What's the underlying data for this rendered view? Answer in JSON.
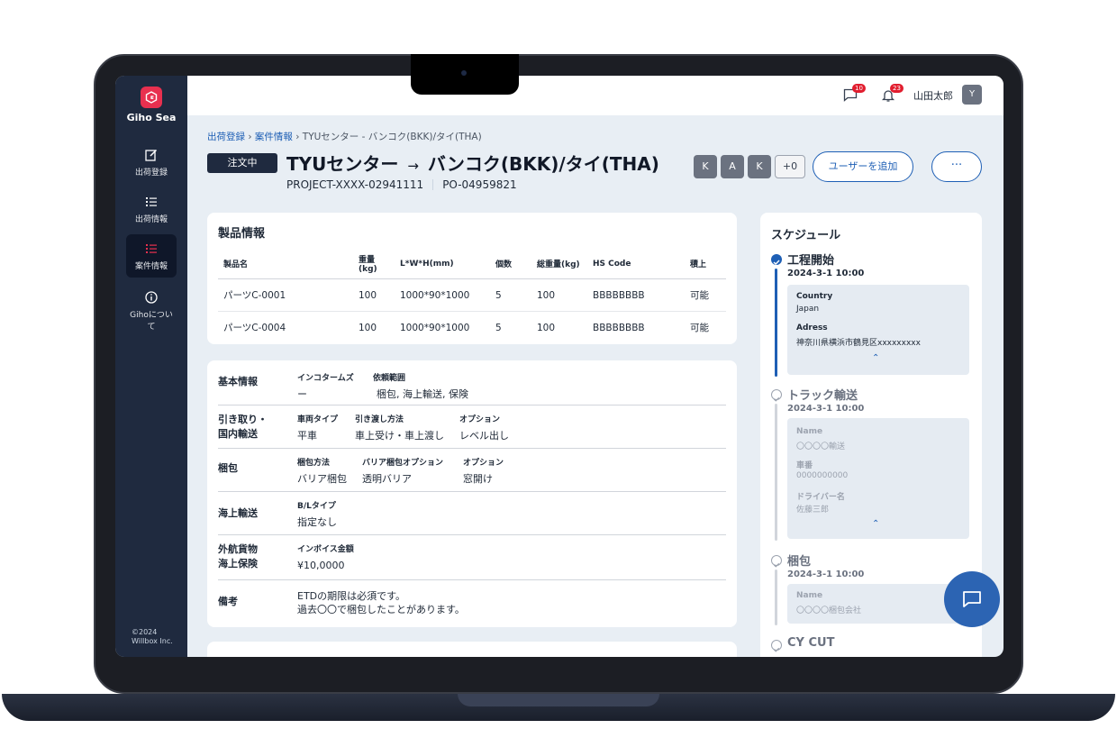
{
  "app": {
    "name": "Giho Sea",
    "copyright_line1": "©2024",
    "copyright_line2": "Willbox Inc."
  },
  "sidebar": {
    "items": [
      {
        "label": "出荷登録",
        "icon": "edit-icon",
        "active": false
      },
      {
        "label": "出荷情報",
        "icon": "list-icon",
        "active": false
      },
      {
        "label": "案件情報",
        "icon": "list-icon",
        "active": true
      },
      {
        "label": "Gihoについて",
        "icon": "info-icon",
        "active": false
      }
    ]
  },
  "topbar": {
    "messages_count": "10",
    "notifications_count": "23",
    "username": "山田太郎",
    "avatar_initial": "Y"
  },
  "breadcrumb": {
    "item1": "出荷登録",
    "item2": "案件情報",
    "current": "TYUセンター - バンコク(BKK)/タイ(THA)",
    "sep": "›"
  },
  "header": {
    "status": "注文中",
    "title_from": "TYUセンター",
    "arrow": "→",
    "title_to": "バンコク(BKK)/タイ(THA)",
    "project_id": "PROJECT-XXXX-02941111",
    "po_number": "PO-04959821",
    "users": [
      "K",
      "A",
      "K"
    ],
    "more_users": "+0",
    "add_user_label": "ユーザーを追加",
    "more_label": "···"
  },
  "product_card": {
    "title": "製品情報",
    "columns": [
      "製品名",
      "重量(kg)",
      "L*W*H(mm)",
      "個数",
      "総重量(kg)",
      "HS Code",
      "積上"
    ],
    "rows": [
      [
        "パーツC-0001",
        "100",
        "1000*90*1000",
        "5",
        "100",
        "BBBBBBBB",
        "可能"
      ],
      [
        "パーツC-0004",
        "100",
        "1000*90*1000",
        "5",
        "100",
        "BBBBBBBB",
        "可能"
      ]
    ]
  },
  "info_card": {
    "basic": {
      "label": "基本情報",
      "incoterms_k": "インコタームズ",
      "incoterms_v": "ー",
      "scope_k": "依頼範囲",
      "scope_v": "梱包, 海上輸送, 保険"
    },
    "pickup": {
      "label1": "引き取り・",
      "label2": "国内輸送",
      "vehicle_k": "車両タイプ",
      "vehicle_v": "平車",
      "delivery_k": "引き渡し方法",
      "delivery_v": "車上受け・車上渡し",
      "option_k": "オプション",
      "option_v": "レベル出し"
    },
    "packing": {
      "label": "梱包",
      "method_k": "梱包方法",
      "method_v": "バリア梱包",
      "barrier_k": "バリア梱包オプション",
      "barrier_v": "透明バリア",
      "option_k": "オプション",
      "option_v": "窓開け"
    },
    "ocean": {
      "label": "海上輸送",
      "bl_k": "B/Lタイプ",
      "bl_v": "指定なし"
    },
    "insurance": {
      "label1": "外航貨物",
      "label2": "海上保険",
      "invoice_k": "インボイス金額",
      "invoice_v": "¥10,0000"
    },
    "notes": {
      "label": "備考",
      "line1": "ETDの期限は必須です。",
      "line2": "過去〇〇で梱包したことがあります。"
    }
  },
  "schedule": {
    "title": "スケジュール",
    "steps": [
      {
        "name": "工程開始",
        "date": "2024-3-1 10:00",
        "f1k": "Country",
        "f1v": "Japan",
        "f2k": "Adress",
        "f2v": "神奈川県横浜市鶴見区xxxxxxxxx"
      },
      {
        "name": "トラック輸送",
        "date": "2024-3-1 10:00",
        "f1k": "Name",
        "f1v": "〇〇〇〇輸送",
        "f2k": "車番",
        "f2v": "0000000000",
        "f3k": "ドライバー名",
        "f3v": "佐藤三郎"
      },
      {
        "name": "梱包",
        "date": "2024-3-1 10:00",
        "f1k": "Name",
        "f1v": "〇〇〇〇梱包会社"
      },
      {
        "name": "CY CUT"
      }
    ],
    "chevron": "⌃"
  },
  "colors": {
    "sidebar_bg": "#1f2a3f",
    "accent": "#1e5fb5",
    "badge": "#e11d2e",
    "fab": "#2c64b3"
  }
}
